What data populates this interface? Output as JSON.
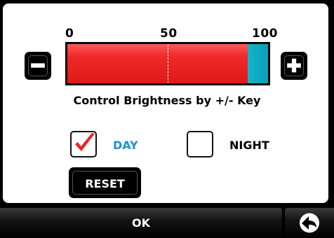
{
  "scale": {
    "min_label": "0",
    "mid_label": "50",
    "max_label": "100"
  },
  "brightness": {
    "level_percent": 90,
    "fill_color": "#e81f1f",
    "remaining_color": "#12b4c8"
  },
  "controls": {
    "minus_icon": "minus-icon",
    "plus_icon": "plus-icon"
  },
  "hint": "Control Brightness by +/- Key",
  "modes": {
    "day_label": "DAY",
    "day_checked": true,
    "night_label": "NIGHT",
    "night_checked": false,
    "check_color": "#e8232a",
    "day_color": "#1f8fd8"
  },
  "reset_label": "RESET",
  "footer": {
    "ok_label": "OK",
    "back_icon": "back-arrow-icon"
  }
}
